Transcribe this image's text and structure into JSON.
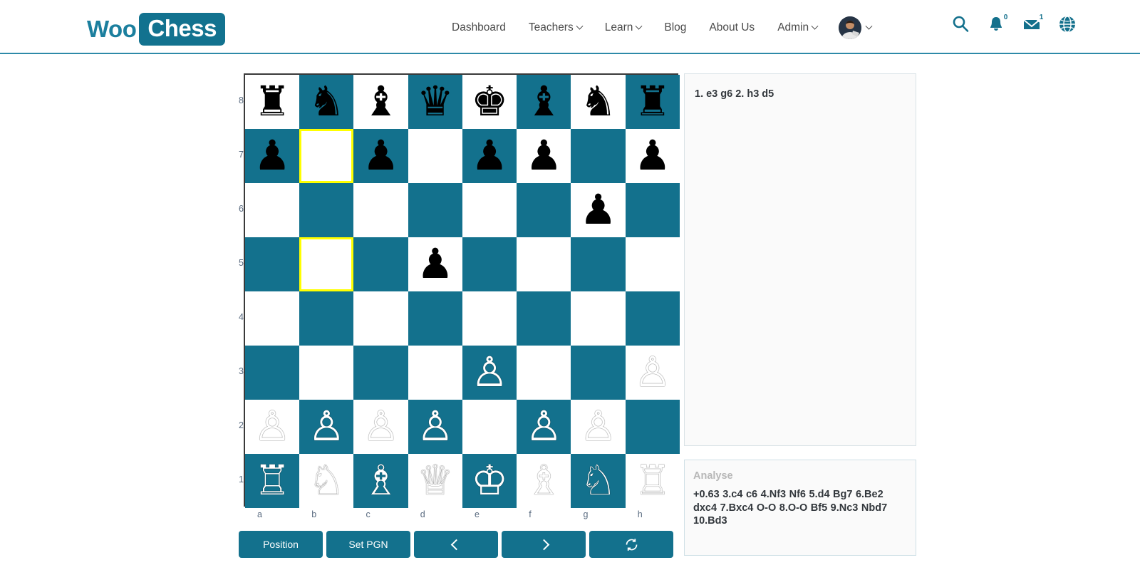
{
  "brand": {
    "part1": "Woo",
    "part2": "Chess"
  },
  "nav": {
    "items": [
      {
        "label": "Dashboard",
        "has_caret": false
      },
      {
        "label": "Teachers",
        "has_caret": true
      },
      {
        "label": "Learn",
        "has_caret": true
      },
      {
        "label": "Blog",
        "has_caret": false
      },
      {
        "label": "About Us",
        "has_caret": false
      },
      {
        "label": "Admin",
        "has_caret": true
      }
    ]
  },
  "header_icons": {
    "search": {
      "name": "search-icon"
    },
    "notifications": {
      "name": "bell-icon",
      "badge": "0"
    },
    "messages": {
      "name": "envelope-icon",
      "badge": "1"
    },
    "language": {
      "name": "globe-icon"
    }
  },
  "colors": {
    "brand_teal": "#12728f",
    "board_dark": "#13718d",
    "board_light": "#ffffff",
    "highlight": "#ffff00",
    "button": "#13718d"
  },
  "board": {
    "rank_labels": [
      "8",
      "7",
      "6",
      "5",
      "4",
      "3",
      "2",
      "1"
    ],
    "file_labels": [
      "a",
      "b",
      "c",
      "d",
      "e",
      "f",
      "g",
      "h"
    ],
    "highlighted_squares": [
      "b7",
      "b5"
    ],
    "dragging_piece": {
      "square": "b5",
      "glyph": "♟",
      "color": "b"
    },
    "rows": [
      [
        "♜",
        "♞",
        "♝",
        "♛",
        "♚",
        "♝",
        "♞",
        "♜"
      ],
      [
        "♟",
        "",
        "♟",
        "",
        "♟",
        "♟",
        "",
        "♟"
      ],
      [
        "",
        "",
        "",
        "",
        "",
        "",
        "♟",
        ""
      ],
      [
        "",
        "",
        "",
        "♟",
        "",
        "",
        "",
        ""
      ],
      [
        "",
        "",
        "",
        "",
        "",
        "",
        "",
        ""
      ],
      [
        "",
        "",
        "",
        "",
        "♙",
        "",
        "",
        "♙"
      ],
      [
        "♙",
        "♙",
        "♙",
        "♙",
        "",
        "♙",
        "♙",
        ""
      ],
      [
        "♖",
        "♘",
        "♗",
        "♕",
        "♔",
        "♗",
        "♘",
        "♖"
      ]
    ],
    "row_colors": [
      [
        "b",
        "b",
        "b",
        "b",
        "b",
        "b",
        "b",
        "b"
      ],
      [
        "b",
        "",
        "b",
        "",
        "b",
        "b",
        "",
        "b"
      ],
      [
        "",
        "",
        "",
        "",
        "",
        "",
        "b",
        ""
      ],
      [
        "",
        "",
        "",
        "b",
        "",
        "",
        "",
        ""
      ],
      [
        "",
        "",
        "",
        "",
        "",
        "",
        "",
        ""
      ],
      [
        "",
        "",
        "",
        "",
        "w",
        "",
        "",
        "w"
      ],
      [
        "w",
        "w",
        "w",
        "w",
        "",
        "w",
        "w",
        ""
      ],
      [
        "w",
        "w",
        "w",
        "w",
        "w",
        "w",
        "w",
        "w"
      ]
    ]
  },
  "buttons": {
    "position": "Position",
    "set_pgn": "Set PGN",
    "prev": "",
    "next": "",
    "flip": ""
  },
  "moves": {
    "pgn": "1. e3 g6 2. h3 d5"
  },
  "analyse": {
    "title": "Analyse",
    "line": "+0.63 3.c4 c6 4.Nf3 Nf6 5.d4 Bg7 6.Be2 dxc4 7.Bxc4 O-O 8.O-O Bf5 9.Nc3 Nbd7 10.Bd3"
  }
}
